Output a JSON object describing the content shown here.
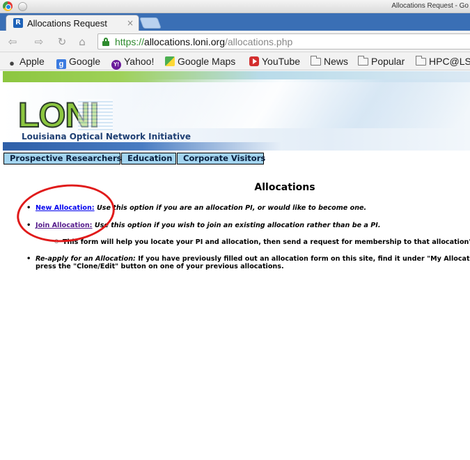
{
  "window": {
    "title": "Allocations Request - Go"
  },
  "tab": {
    "title": "Allocations Request",
    "close": "×",
    "favicon": "R"
  },
  "toolbar": {
    "url_scheme": "https://",
    "url_host": "allocations.loni.org",
    "url_path": "/allocations.php"
  },
  "bookmarks": [
    {
      "label": "Apple",
      "icon": "apple-icon"
    },
    {
      "label": "Google",
      "icon": "google-icon"
    },
    {
      "label": "Yahoo!",
      "icon": "yahoo-icon"
    },
    {
      "label": "Google Maps",
      "icon": "maps-icon"
    },
    {
      "label": "YouTube",
      "icon": "youtube-icon"
    },
    {
      "label": "News",
      "icon": "folder-icon"
    },
    {
      "label": "Popular",
      "icon": "folder-icon"
    },
    {
      "label": "HPC@LSU",
      "icon": "folder-icon"
    }
  ],
  "banner": {
    "logo": "LONI",
    "subtitle": "Louisiana Optical Network Initiative"
  },
  "topnav": [
    "Prospective Researchers",
    "Education",
    "Corporate Visitors"
  ],
  "main": {
    "title": "Allocations",
    "items": [
      {
        "link": "New Allocation:",
        "text": " Use this option if you are an allocation PI, or would like to become one."
      },
      {
        "link": "Join Allocation:",
        "text": " Use this option if you wish to join an existing allocation rather than be a PI."
      }
    ],
    "sub_item": "This form will help you locate your PI and allocation, then send a request for membership to that allocation's PI.",
    "reapply": {
      "em": "Re-apply for an Allocation:",
      "text": " If you have previously filled out an allocation form on this site, find it under \"My Allocations\" and",
      "text2": "press the \"Clone/Edit\" button on one of your previous allocations."
    }
  },
  "colors": {
    "tabstrip": "#3a6fb5",
    "logo_green": "#8cc63f",
    "nav_tab": "#a3d4ef",
    "annotation": "#e01a1a"
  }
}
